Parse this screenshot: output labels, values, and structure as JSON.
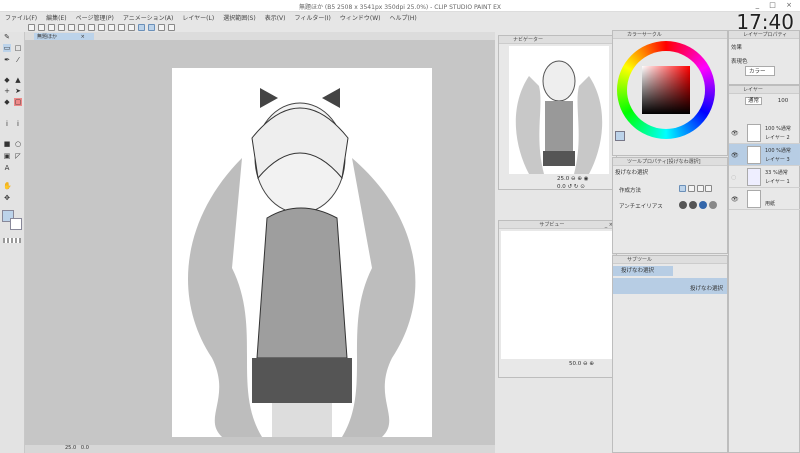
{
  "window": {
    "title": "無題ほか (B5 2508 x 3541px 350dpi 25.0%) - CLIP STUDIO PAINT EX",
    "controls": "_ □ ×"
  },
  "clock": "17:40",
  "menu": [
    "ファイル(F)",
    "編集(E)",
    "ページ管理(P)",
    "アニメーション(A)",
    "レイヤー(L)",
    "選択範囲(S)",
    "表示(V)",
    "フィルター(I)",
    "ウィンドウ(W)",
    "ヘルプ(H)"
  ],
  "document_tab": {
    "label": "無題ほか",
    "close": "×"
  },
  "status": {
    "zoom": "25.0",
    "angle": "0.0"
  },
  "navigator": {
    "title": "ナビゲーター",
    "zoom": "25.0",
    "angle": "0.0"
  },
  "subview": {
    "title": "サブビュー",
    "zoom": "50.0",
    "controls": "_ ×"
  },
  "color_panel": {
    "title": "カラーサークル",
    "hue_color": "#ff0000"
  },
  "tool_property": {
    "title": "ツールプロパティ[投げなわ選択]",
    "tool_name": "投げなわ選択",
    "creation_label": "作成方法",
    "antialias_label": "アンチエイリアス"
  },
  "subtool": {
    "title": "サブツール",
    "group": "投げなわ選択",
    "item": "投げなわ選択"
  },
  "layer_property": {
    "title": "レイヤープロパティ",
    "effect_label": "効果",
    "expression_label": "表現色",
    "expression_value": "カラー"
  },
  "layers": {
    "title": "レイヤー",
    "blend_mode": "通常",
    "opacity": "100",
    "items": [
      {
        "opacity_mode": "100 %通常",
        "name": "レイヤー 2",
        "visible": true,
        "selected": false
      },
      {
        "opacity_mode": "100 %通常",
        "name": "レイヤー 3",
        "visible": true,
        "selected": true
      },
      {
        "opacity_mode": "33 %通常",
        "name": "レイヤー 1",
        "visible": false,
        "selected": false
      },
      {
        "opacity_mode": "",
        "name": "用紙",
        "visible": true,
        "selected": false
      }
    ]
  }
}
